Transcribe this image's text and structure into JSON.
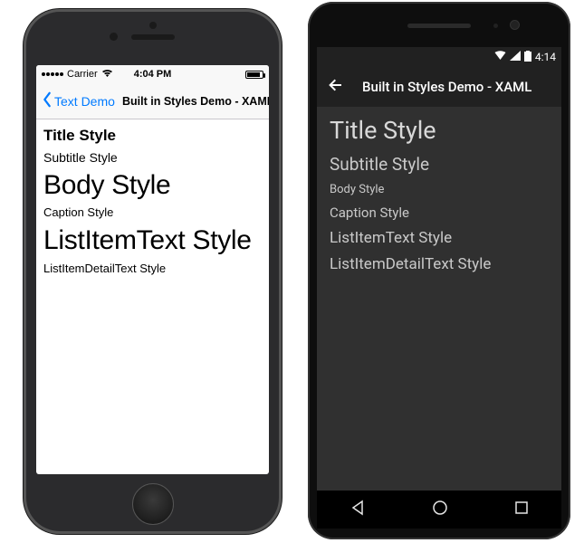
{
  "ios": {
    "status": {
      "carrier": "Carrier",
      "wifi_icon": "wifi-icon",
      "time": "4:04 PM"
    },
    "nav": {
      "back_label": "Text Demo",
      "title": "Built in Styles Demo - XAML"
    },
    "styles": {
      "title": "Title Style",
      "subtitle": "Subtitle Style",
      "body": "Body Style",
      "caption": "Caption Style",
      "listitem": "ListItemText Style",
      "listitemdetail": "ListItemDetailText Style"
    }
  },
  "android": {
    "status": {
      "time": "4:14"
    },
    "appbar": {
      "title": "Built in Styles Demo - XAML"
    },
    "styles": {
      "title": "Title Style",
      "subtitle": "Subtitle Style",
      "body": "Body Style",
      "caption": "Caption Style",
      "listitem": "ListItemText Style",
      "listitemdetail": "ListItemDetailText Style"
    }
  }
}
